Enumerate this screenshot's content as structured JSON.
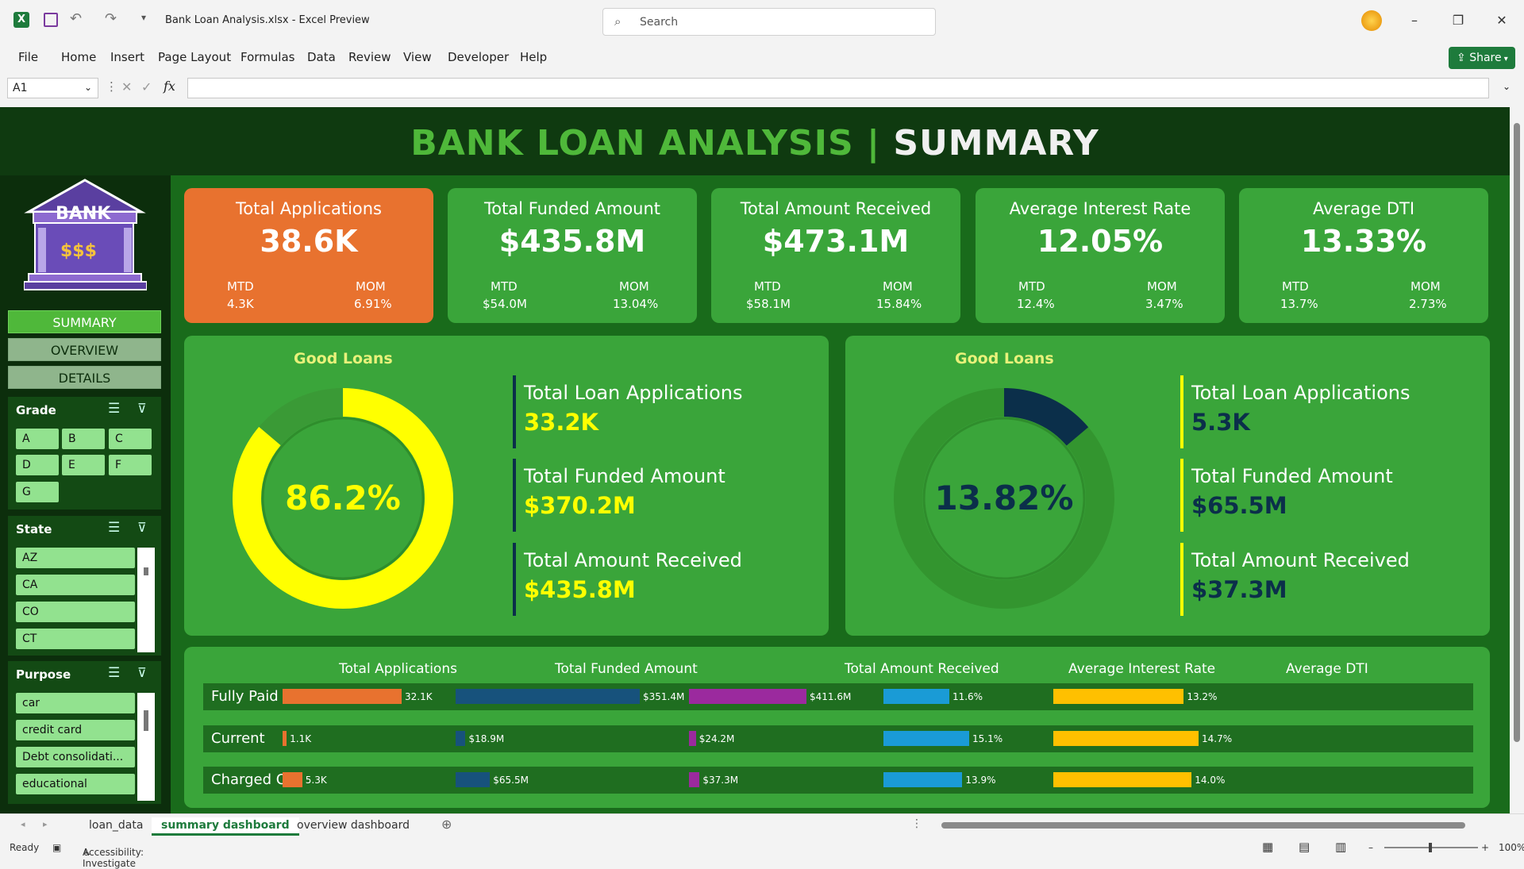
{
  "window": {
    "title": "Bank Loan Analysis.xlsx  -  Excel Preview",
    "search_placeholder": "Search"
  },
  "menu": [
    "File",
    "Home",
    "Insert",
    "Page Layout",
    "Formulas",
    "Data",
    "Review",
    "View",
    "Developer",
    "Help"
  ],
  "share_label": "Share",
  "formula": {
    "name_box": "A1",
    "fx": "fx"
  },
  "dashboard": {
    "title_main": "BANK LOAN ANALYSIS",
    "title_sep": "|",
    "title_sub": "SUMMARY",
    "logo_text": "BANK",
    "logo_money": "$$$",
    "nav": [
      "SUMMARY",
      "OVERVIEW",
      "DETAILS"
    ],
    "slicers": {
      "grade": {
        "title": "Grade",
        "items": [
          "A",
          "B",
          "C",
          "D",
          "E",
          "F",
          "G"
        ]
      },
      "state": {
        "title": "State",
        "items": [
          "AZ",
          "CA",
          "CO",
          "CT"
        ]
      },
      "purpose": {
        "title": "Purpose",
        "items": [
          "car",
          "credit card",
          "Debt consolidati...",
          "educational"
        ]
      }
    },
    "kpis": [
      {
        "title": "Total Applications",
        "value": "38.6K",
        "mtd_label": "MTD",
        "mtd": "4.3K",
        "mom_label": "MOM",
        "mom": "6.91%",
        "color": "#e8722f"
      },
      {
        "title": "Total Funded Amount",
        "value": "$435.8M",
        "mtd_label": "MTD",
        "mtd": "$54.0M",
        "mom_label": "MOM",
        "mom": "13.04%",
        "color": "#3aa53a"
      },
      {
        "title": "Total Amount Received",
        "value": "$473.1M",
        "mtd_label": "MTD",
        "mtd": "$58.1M",
        "mom_label": "MOM",
        "mom": "15.84%",
        "color": "#3aa53a"
      },
      {
        "title": "Average Interest Rate",
        "value": "12.05%",
        "mtd_label": "MTD",
        "mtd": "12.4%",
        "mom_label": "MOM",
        "mom": "3.47%",
        "color": "#3aa53a"
      },
      {
        "title": "Average DTI",
        "value": "13.33%",
        "mtd_label": "MTD",
        "mtd": "13.7%",
        "mom_label": "MOM",
        "mom": "2.73%",
        "color": "#3aa53a"
      }
    ],
    "good_loans": {
      "title": "Good Loans",
      "percent_label": "86.2%",
      "percent": 86.2,
      "metrics": [
        {
          "label": "Total Loan Applications",
          "value": "33.2K"
        },
        {
          "label": "Total Funded Amount",
          "value": "$370.2M"
        },
        {
          "label": "Total Amount Received",
          "value": "$435.8M"
        }
      ]
    },
    "bad_loans": {
      "title": "Good Loans",
      "percent_label": "13.82%",
      "percent": 13.82,
      "metrics": [
        {
          "label": "Total Loan Applications",
          "value": "5.3K"
        },
        {
          "label": "Total Funded Amount",
          "value": "$65.5M"
        },
        {
          "label": "Total Amount Received",
          "value": "$37.3M"
        }
      ]
    },
    "status_table": {
      "columns": [
        "Total Applications",
        "Total Funded Amount",
        "Total Amount Received",
        "Average Interest Rate",
        "Average DTI"
      ],
      "colors": [
        "#e8722f",
        "#17527c",
        "#9b2a9e",
        "#1a9bd6",
        "#ffc000"
      ],
      "rows": [
        {
          "status": "Fully Paid",
          "labels": [
            "32.1K",
            "$351.4M",
            "$411.6M",
            "11.6%",
            "13.2%"
          ],
          "values": [
            32.1,
            351.4,
            411.6,
            11.6,
            13.2
          ]
        },
        {
          "status": "Current",
          "labels": [
            "1.1K",
            "$18.9M",
            "$24.2M",
            "15.1%",
            "14.7%"
          ],
          "values": [
            1.1,
            18.9,
            24.2,
            15.1,
            14.7
          ]
        },
        {
          "status": "Charged Off",
          "labels": [
            "5.3K",
            "$65.5M",
            "$37.3M",
            "13.9%",
            "14.0%"
          ],
          "values": [
            5.3,
            65.5,
            37.3,
            13.9,
            14.0
          ]
        }
      ]
    }
  },
  "sheet_tabs": [
    "loan_data",
    "summary dashboard",
    "overview dashboard"
  ],
  "status": {
    "ready": "Ready",
    "accessibility": "Accessibility: Investigate",
    "zoom": "100%"
  }
}
